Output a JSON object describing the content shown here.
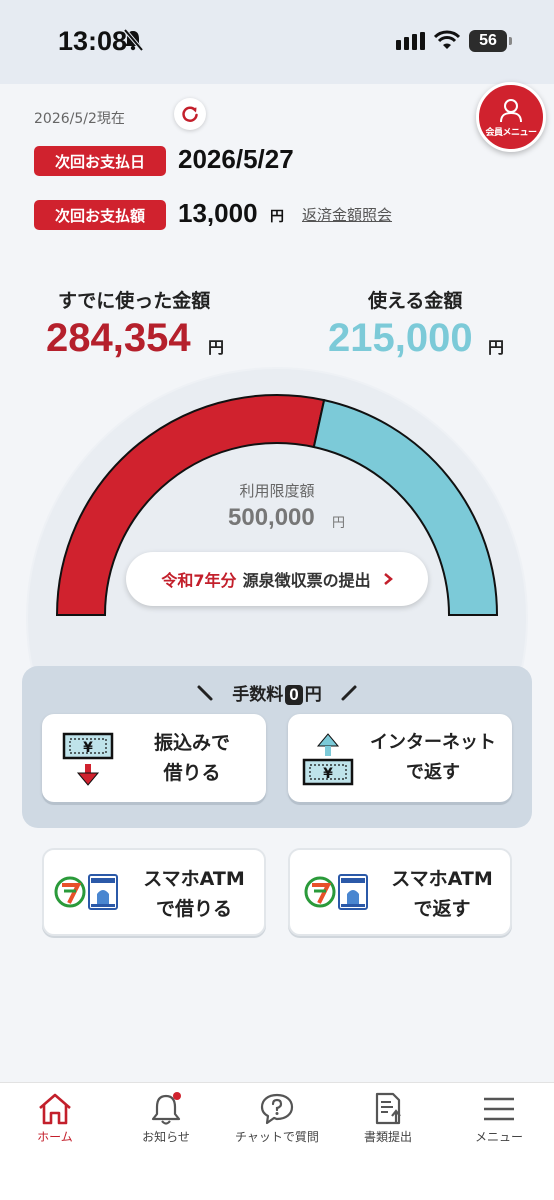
{
  "status_bar": {
    "time": "13:08",
    "battery": "56"
  },
  "header": {
    "as_of": "2026/5/2現在",
    "member_menu": "会員メニュー",
    "next_payment_date_label": "次回お支払日",
    "next_payment_date": "2026/5/27",
    "next_payment_amount_label": "次回お支払額",
    "next_payment_amount": "13,000",
    "yen": "円",
    "repay_inquiry_link": "返済金額照会"
  },
  "usage": {
    "used_label": "すでに使った金額",
    "used_value": "284,354",
    "available_label": "使える金額",
    "available_value": "215,000",
    "limit_label": "利用限度額",
    "limit_value": "500,000",
    "used_fraction": 0.5687,
    "colors": {
      "used": "#d0222e",
      "available": "#7ccad8"
    }
  },
  "tax_button": {
    "year_label": "令和7年分",
    "text": "源泉徴収票の提出"
  },
  "fee_panel": {
    "title_prefix": "手数料",
    "title_zero": "0",
    "title_suffix": "円",
    "transfer_borrow": {
      "line1": "振込みで",
      "line2": "借りる"
    },
    "internet_repay": {
      "line1": "インターネット",
      "line2": "で返す"
    }
  },
  "atm": {
    "borrow": {
      "line1": "スマホATM",
      "line2": "で借りる"
    },
    "repay": {
      "line1": "スマホATM",
      "line2": "で返す"
    }
  },
  "bottom_nav": [
    {
      "label": "ホーム",
      "icon": "home-icon"
    },
    {
      "label": "お知らせ",
      "icon": "bell-icon"
    },
    {
      "label": "チャットで質問",
      "icon": "chat-question-icon"
    },
    {
      "label": "書類提出",
      "icon": "document-upload-icon"
    },
    {
      "label": "メニュー",
      "icon": "hamburger-icon"
    }
  ]
}
